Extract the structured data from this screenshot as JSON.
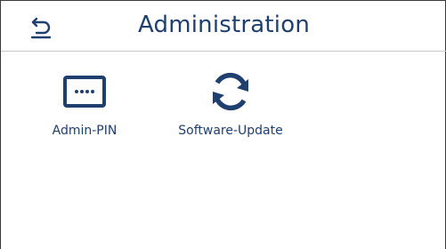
{
  "header": {
    "title": "Administration",
    "back_icon": "back-arrow-icon"
  },
  "tiles": [
    {
      "label": "Admin-PIN",
      "icon": "pin-keypad-icon"
    },
    {
      "label": "Software-Update",
      "icon": "refresh-icon"
    }
  ],
  "colors": {
    "accent": "#1f3f6e",
    "divider": "#c9c9c9",
    "frame": "#3a3a3a"
  }
}
